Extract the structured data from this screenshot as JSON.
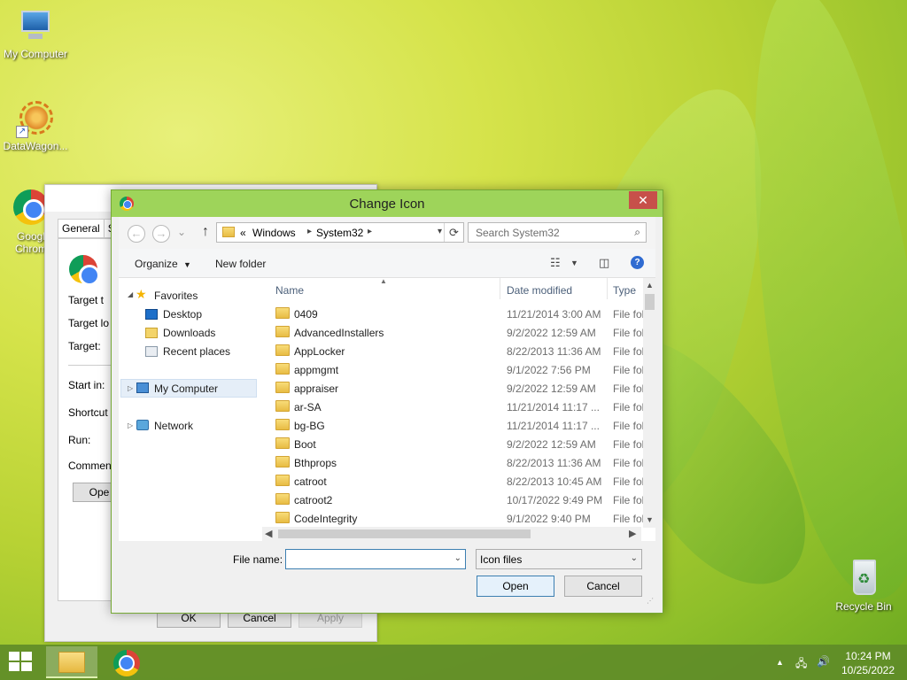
{
  "desktop": {
    "icons": [
      {
        "label": "My Computer"
      },
      {
        "label": "DataWagon..."
      },
      {
        "label_line1": "Googl",
        "label_line2": "Chrom"
      },
      {
        "label": "Recycle Bin"
      }
    ]
  },
  "properties_window": {
    "tabs": [
      "General",
      "S"
    ],
    "fields": [
      "Target t",
      "Target lo",
      "Target:",
      "Start in:",
      "Shortcut",
      "Run:",
      "Commen"
    ],
    "open_button": "Ope",
    "ok": "OK",
    "cancel": "Cancel",
    "apply": "Apply"
  },
  "dialog": {
    "title": "Change Icon",
    "close_glyph": "✕",
    "address": {
      "overflow": "«",
      "segments": [
        "Windows",
        "System32"
      ]
    },
    "search_placeholder": "Search System32",
    "toolbar": {
      "organize": "Organize",
      "new_folder": "New folder"
    },
    "nav_pane": {
      "favorites": "Favorites",
      "favorites_items": [
        "Desktop",
        "Downloads",
        "Recent places"
      ],
      "my_computer": "My Computer",
      "network": "Network"
    },
    "columns": {
      "name": "Name",
      "date": "Date modified",
      "type": "Type"
    },
    "files": [
      {
        "name": "0409",
        "date": "11/21/2014 3:00 AM",
        "type": "File fol"
      },
      {
        "name": "AdvancedInstallers",
        "date": "9/2/2022 12:59 AM",
        "type": "File fol"
      },
      {
        "name": "AppLocker",
        "date": "8/22/2013 11:36 AM",
        "type": "File fol"
      },
      {
        "name": "appmgmt",
        "date": "9/1/2022 7:56 PM",
        "type": "File fol"
      },
      {
        "name": "appraiser",
        "date": "9/2/2022 12:59 AM",
        "type": "File fol"
      },
      {
        "name": "ar-SA",
        "date": "11/21/2014 11:17 ...",
        "type": "File fol"
      },
      {
        "name": "bg-BG",
        "date": "11/21/2014 11:17 ...",
        "type": "File fol"
      },
      {
        "name": "Boot",
        "date": "9/2/2022 12:59 AM",
        "type": "File fol"
      },
      {
        "name": "Bthprops",
        "date": "8/22/2013 11:36 AM",
        "type": "File fol"
      },
      {
        "name": "catroot",
        "date": "8/22/2013 10:45 AM",
        "type": "File fol"
      },
      {
        "name": "catroot2",
        "date": "10/17/2022 9:49 PM",
        "type": "File fol"
      },
      {
        "name": "CodeIntegrity",
        "date": "9/1/2022 9:40 PM",
        "type": "File fol"
      }
    ],
    "file_name_label": "File name:",
    "file_name_value": "",
    "file_type": "Icon files",
    "open_button": "Open",
    "cancel_button": "Cancel"
  },
  "taskbar": {
    "time": "10:24 PM",
    "date": "10/25/2022"
  },
  "colors": {
    "dialog_frame": "#9ed45a",
    "close_button": "#c7504a",
    "taskbar": "#5f8c28",
    "selection": "#e5eef8"
  }
}
